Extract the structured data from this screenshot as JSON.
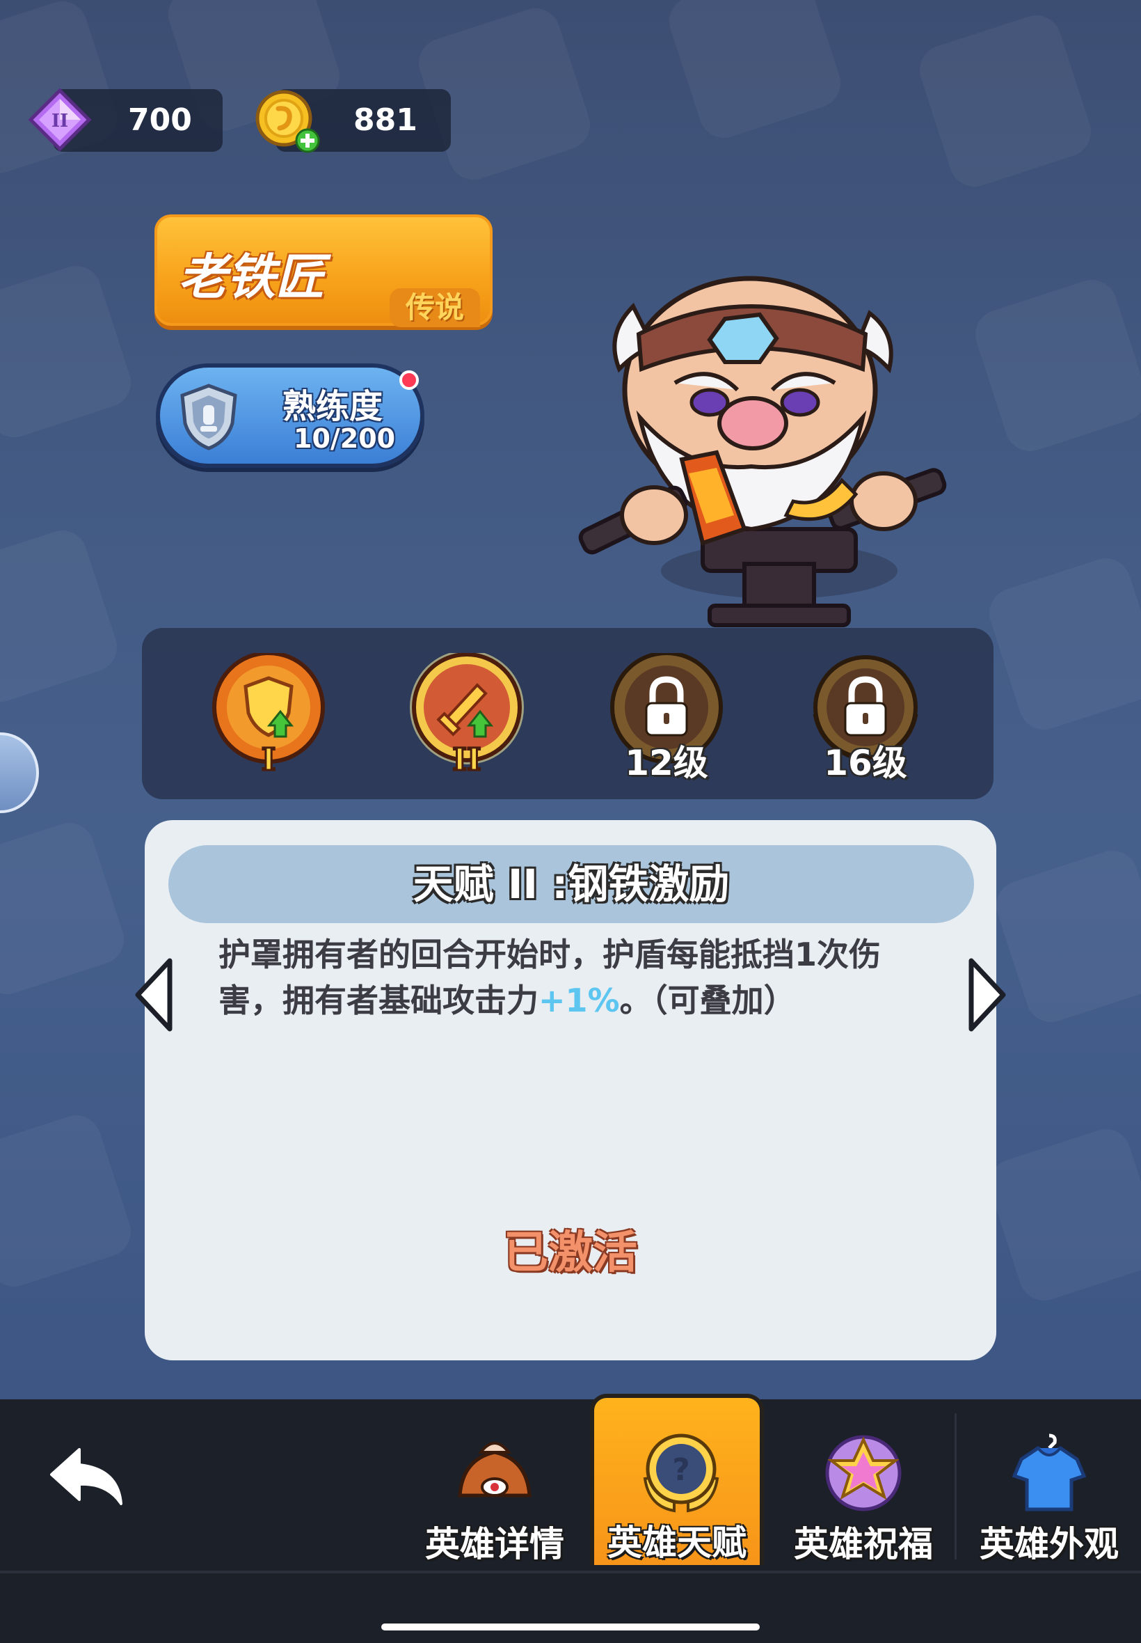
{
  "currency": {
    "gems": {
      "icon": "purple-gem-icon",
      "value": "700"
    },
    "coins": {
      "icon": "gold-coin-plus-icon",
      "value": "881"
    }
  },
  "hero": {
    "name": "老铁匠",
    "rarity": "传说",
    "mastery_label": "熟练度",
    "mastery_value": "10/200"
  },
  "talents": [
    {
      "id": "talent-1",
      "icon": "shield-upgrade-icon",
      "label": "",
      "state": "unlocked"
    },
    {
      "id": "talent-2",
      "icon": "sword-upgrade-icon",
      "label": "",
      "state": "selected"
    },
    {
      "id": "talent-3",
      "icon": "lock-icon",
      "label": "12级",
      "state": "locked"
    },
    {
      "id": "talent-4",
      "icon": "lock-icon",
      "label": "16级",
      "state": "locked"
    }
  ],
  "detail": {
    "title": "天赋 II :钢铁激励",
    "desc_before": "护罩拥有者的回合开始时，护盾每能抵挡1次伤害，拥有者基础攻击力",
    "desc_highlight": "+1%",
    "desc_after": "。（可叠加）",
    "status": "已激活"
  },
  "nav": {
    "tabs": [
      {
        "label": "英雄详情",
        "icon": "hero-detail-icon"
      },
      {
        "label": "英雄天赋",
        "icon": "hero-talent-icon",
        "active": true
      },
      {
        "label": "英雄祝福",
        "icon": "hero-blessing-icon"
      },
      {
        "label": "英雄外观",
        "icon": "hero-outfit-icon"
      }
    ]
  },
  "colors": {
    "accent_orange": "#f7a21a",
    "highlight_blue": "#5cc6f0",
    "status_salmon": "#f3916a"
  }
}
